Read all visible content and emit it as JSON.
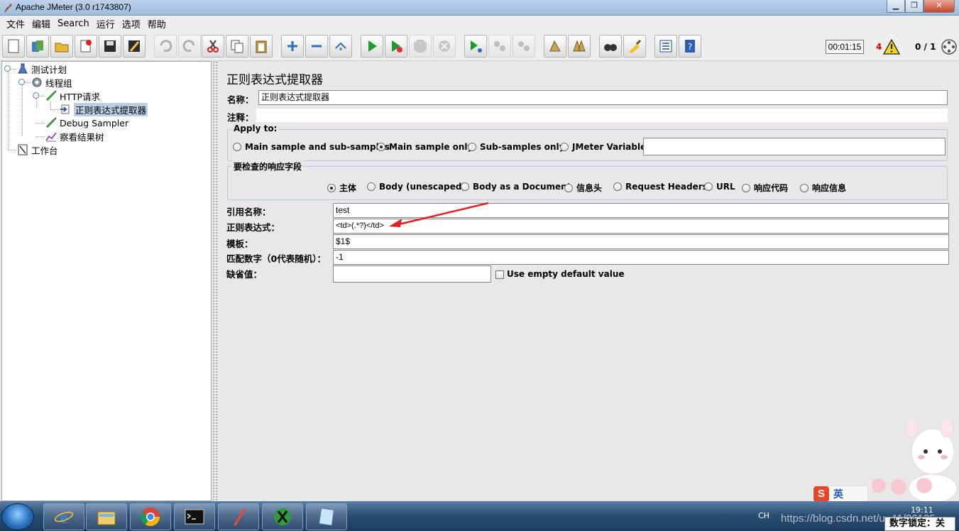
{
  "window": {
    "title": "Apache JMeter (3.0 r1743807)"
  },
  "menubar": [
    "文件",
    "编辑",
    "Search",
    "运行",
    "选项",
    "帮助"
  ],
  "toolbar": {
    "timer": "00:01:15",
    "error_count": "4",
    "threads": "0 / 1",
    "icons": [
      "new-icon",
      "templates-icon",
      "open-icon",
      "close-icon",
      "save-icon",
      "save-as-icon",
      "undo-icon",
      "redo-icon",
      "cut-icon",
      "copy-icon",
      "paste-icon",
      "expand-icon",
      "collapse-icon",
      "toggle-icon",
      "start-icon",
      "start-no-pause-icon",
      "stop-icon",
      "shutdown-icon",
      "remote-start-icon",
      "remote-stop-icon",
      "remote-shutdown-icon",
      "clear-icon",
      "clear-all-icon",
      "search-icon",
      "reset-search-icon",
      "function-helper-icon",
      "help-icon"
    ]
  },
  "tree": {
    "nodes": [
      {
        "label": "测试计划",
        "icon": "test-plan-icon"
      },
      {
        "label": "线程组",
        "icon": "thread-group-icon"
      },
      {
        "label": "HTTP请求",
        "icon": "sampler-icon"
      },
      {
        "label": "正则表达式提取器",
        "icon": "extractor-icon",
        "selected": true
      },
      {
        "label": "Debug Sampler",
        "icon": "sampler-icon"
      },
      {
        "label": "察看结果树",
        "icon": "listener-icon"
      },
      {
        "label": "工作台",
        "icon": "workbench-icon"
      }
    ]
  },
  "panel": {
    "title": "正则表达式提取器",
    "name_label": "名称：",
    "name_value": "正则表达式提取器",
    "comment_label": "注释：",
    "comment_value": "",
    "apply_to": {
      "title": "Apply to:",
      "options": [
        "Main sample and sub-samples",
        "Main sample only",
        "Sub-samples only",
        "JMeter Variable"
      ],
      "selected": "Main sample only",
      "variable_value": ""
    },
    "field_to_check": {
      "title": "要检查的响应字段",
      "options": [
        "主体",
        "Body (unescaped)",
        "Body as a Document",
        "信息头",
        "Request Headers",
        "URL",
        "响应代码",
        "响应信息"
      ],
      "selected": "主体"
    },
    "ref_name_label": "引用名称：",
    "ref_name_value": "test",
    "regex_label": "正则表达式：",
    "regex_value": "<td>(.*?)</td>",
    "template_label": "模板：",
    "template_value": "$1$",
    "match_no_label": "匹配数字（0代表随机）：",
    "match_no_value": "-1",
    "default_label": "缺省值：",
    "default_value": "",
    "use_empty_label": "Use empty default value"
  },
  "taskbar": {
    "apps": [
      "ie-icon",
      "explorer-icon",
      "chrome-icon",
      "cmd-icon",
      "pen-icon",
      "xshell-icon",
      "notepad-icon"
    ],
    "lang": "CH",
    "clock": "19:11",
    "watermark": "https://blog.csdn.net/u_41/06125",
    "numlock": "数字锁定：关",
    "ime_lang": "英"
  }
}
